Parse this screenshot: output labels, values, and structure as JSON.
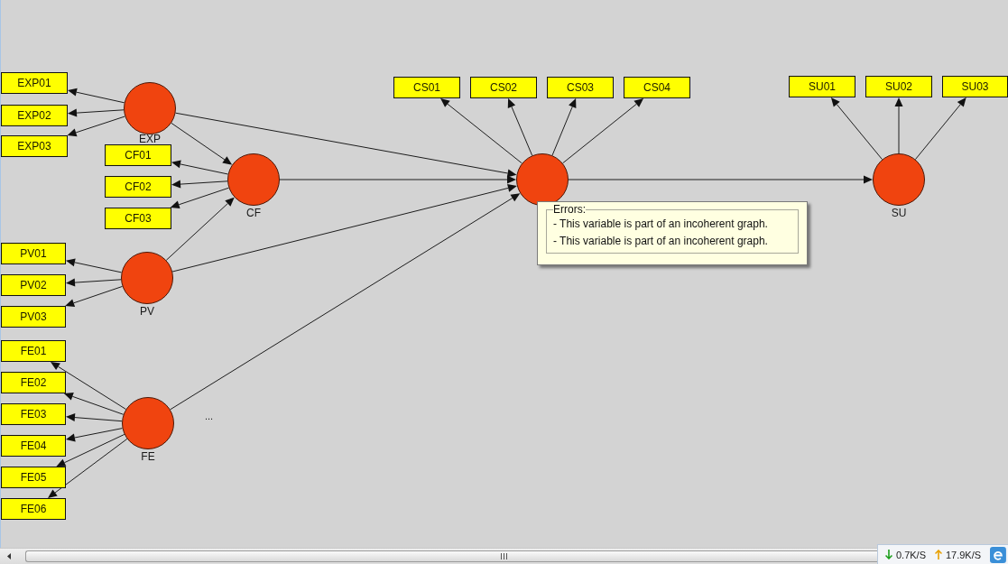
{
  "diagram": {
    "latent_variables": [
      {
        "label": "EXP",
        "indicators": [
          "EXP01",
          "EXP02",
          "EXP03"
        ]
      },
      {
        "label": "CF",
        "indicators": [
          "CF01",
          "CF02",
          "CF03"
        ]
      },
      {
        "label": "PV",
        "indicators": [
          "PV01",
          "PV02",
          "PV03"
        ]
      },
      {
        "label": "FE",
        "indicators": [
          "FE01",
          "FE02",
          "FE03",
          "FE04",
          "FE05",
          "FE06"
        ]
      },
      {
        "indicators": [
          "CS01",
          "CS02",
          "CS03",
          "CS04"
        ]
      },
      {
        "label": "SU",
        "indicators": [
          "SU01",
          "SU02",
          "SU03"
        ]
      }
    ],
    "note": "...",
    "error_tooltip": {
      "title": "Errors:",
      "messages": [
        "- This variable is part of an incoherent graph.",
        "- This variable is part of an incoherent graph."
      ]
    }
  },
  "status_bar": {
    "download_rate": "0.7K/S",
    "upload_rate": "17.9K/S"
  }
}
